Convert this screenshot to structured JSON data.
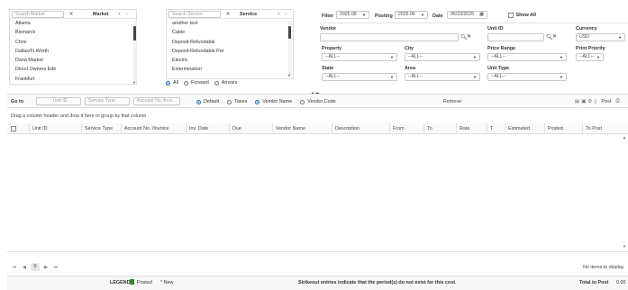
{
  "market_panel": {
    "search_placeholder": "Search Market",
    "clear": "✕",
    "title": "Market",
    "items": [
      "Atlanta",
      "Bismarck",
      "Chris",
      "Dallas/Ft.Worth",
      "Dana Market",
      "Direct Owners Edit",
      "Frankfurt"
    ]
  },
  "service_panel": {
    "search_placeholder": "Search Service",
    "clear": "✕",
    "title": "Service",
    "items": [
      "another test",
      "Cable",
      "Deposit-Refundable",
      "Deposit-Refundable Pet",
      "Electric",
      "Extermination"
    ]
  },
  "scope": {
    "options": [
      "All",
      "Forward",
      "Arrears"
    ],
    "selected": "All"
  },
  "filters": {
    "filter_label": "Filter",
    "filter_value": "2025.06",
    "posting_label": "Posting",
    "posting_value": "2025.06",
    "date_label": "Date",
    "date_value": "06/23/2025",
    "show_all_label": "Show All",
    "vendor_label": "Vendor",
    "vendor_value": "",
    "unit_id_label": "Unit ID",
    "unit_id_value": "",
    "currency_label": "Currency",
    "currency_value": "USD",
    "property_label": "Property",
    "property_value": "--ALL--",
    "city_label": "City",
    "city_value": "--ALL--",
    "price_range_label": "Price Range",
    "price_range_value": "--ALL--",
    "print_priority_label": "Print Priority",
    "print_priority_value": "--ALL--",
    "state_label": "State",
    "state_value": "--ALL--",
    "area_label": "Area",
    "area_value": "--ALL--",
    "unit_type_label": "Unit Type",
    "unit_type_value": "--ALL--"
  },
  "toolbar": {
    "goto_label": "Go to",
    "unit_id_placeholder": "Unit ID",
    "service_type_placeholder": "Service Type",
    "account_placeholder": "Account No./Invo...",
    "view_options": [
      "Default",
      "Taxes",
      "Vendor Name",
      "Vendor Code"
    ],
    "retrieve_label": "Retrieve",
    "post_label": "Post"
  },
  "grid": {
    "group_hint": "Drag a column header and drop it here to group by that column",
    "columns": [
      "Unit ID",
      "Service Type",
      "Account No. /Invoice",
      "Inv. Date",
      "Due",
      "Vendor Name",
      "Description",
      "From",
      "To",
      "Rate",
      "T",
      "Estimated",
      "Posted",
      "To Post"
    ],
    "empty_text": "No items to display",
    "page_number": "0"
  },
  "footer": {
    "legend_label": "LEGEND",
    "posted_label": "Posted",
    "new_label": "* New",
    "note": "Strikeout entries indicate that the period(s) do not exist for this cost.",
    "total_label": "Total to Post",
    "total_value": "0.00"
  },
  "colors": {
    "posted_swatch": "#2e8b2e",
    "accent": "#2a6ebd"
  }
}
